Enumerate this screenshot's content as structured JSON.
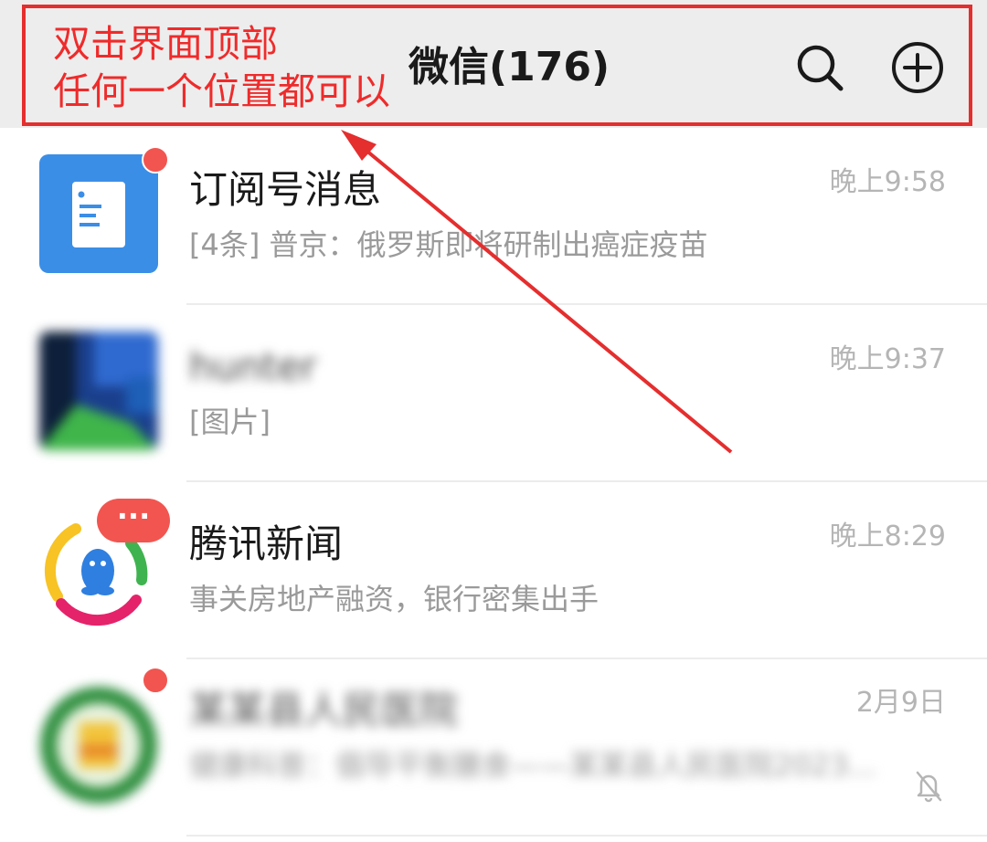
{
  "header": {
    "title": "微信(176)",
    "search_icon": "search-icon",
    "add_icon": "plus-circle-icon",
    "background": "#ededed"
  },
  "annotation": {
    "line1": "双击界面顶部",
    "line2": "任何一个位置都可以",
    "color": "#e52e2e"
  },
  "chats": [
    {
      "name": "订阅号消息",
      "preview": "[4条] 普京：俄罗斯即将研制出癌症疫苗",
      "time": "晚上9:58",
      "avatar_icon": "document-icon",
      "unread_dot": true
    },
    {
      "name": "hunter",
      "preview": "[图片]",
      "time": "晚上9:37",
      "avatar_icon": "blurred-photo-avatar",
      "unread_dot": false
    },
    {
      "name": "腾讯新闻",
      "preview": "事关房地产融资，银行密集出手",
      "time": "晚上8:29",
      "avatar_icon": "penguin-icon",
      "badge": "···"
    },
    {
      "name": "某某县人民医院",
      "preview": "健康科普：倡导平衡膳食——某某县人民医院2023...",
      "time": "2月9日",
      "avatar_icon": "blurred-badge-avatar",
      "unread_dot": true,
      "muted_icon": "bell-off-icon"
    }
  ],
  "colors": {
    "unread": "#f25550",
    "accent_blue": "#3b8ee6",
    "annotation_red": "#e52e2e"
  }
}
